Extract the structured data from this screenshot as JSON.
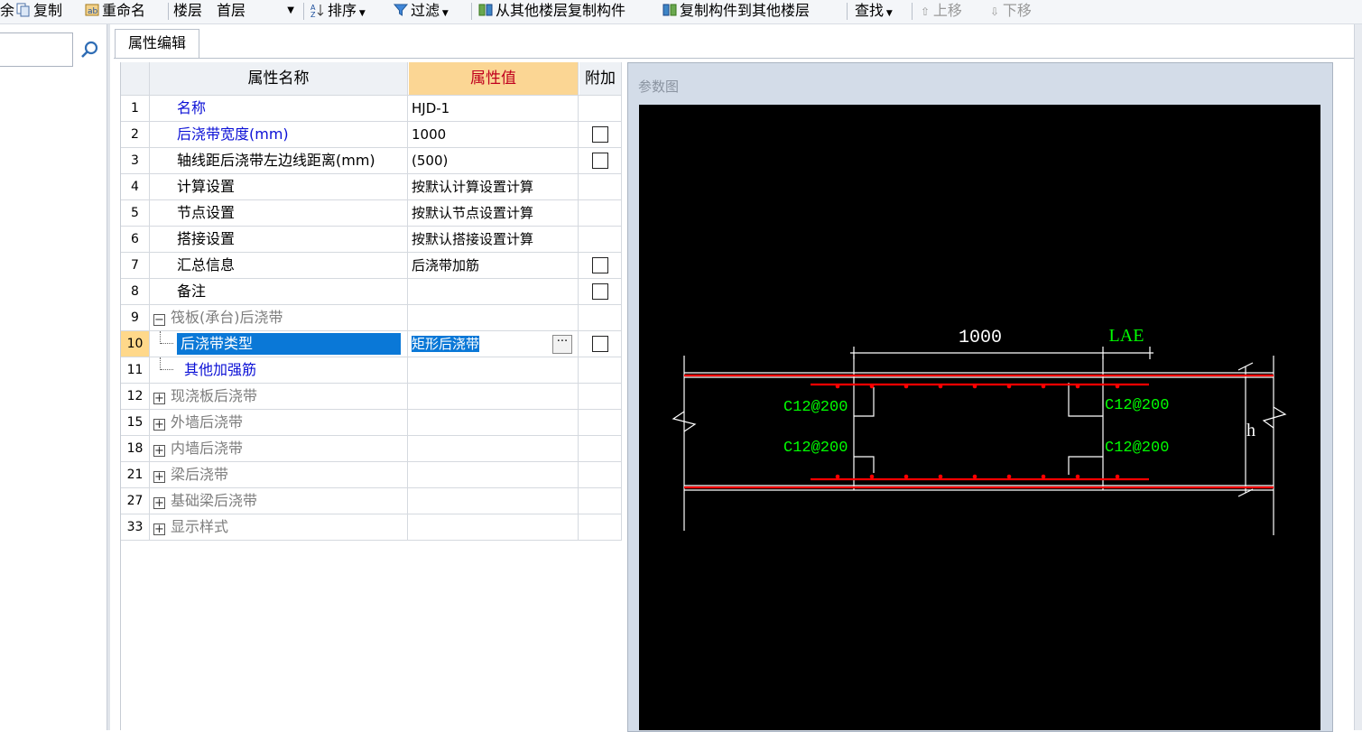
{
  "toolbar": {
    "delete_partial": "余",
    "copy": "复制",
    "rename": "重命名",
    "floor_label": "楼层",
    "floor_value": "首层",
    "sort": "排序",
    "filter": "过滤",
    "copy_from_floor": "从其他楼层复制构件",
    "copy_to_floor": "复制构件到其他楼层",
    "find": "查找",
    "move_up": "上移",
    "move_down": "下移"
  },
  "tab": {
    "label": "属性编辑"
  },
  "grid": {
    "headers": {
      "name": "属性名称",
      "value": "属性值",
      "extra": "附加"
    },
    "rows": [
      {
        "num": "1",
        "name": "名称",
        "value": "HJD-1",
        "checkbox": false
      },
      {
        "num": "2",
        "name": "后浇带宽度(mm)",
        "value": "1000",
        "checkbox": true
      },
      {
        "num": "3",
        "name": "轴线距后浇带左边线距离(mm)",
        "value": "(500)",
        "checkbox": true
      },
      {
        "num": "4",
        "name": "计算设置",
        "value": "按默认计算设置计算",
        "checkbox": false
      },
      {
        "num": "5",
        "name": "节点设置",
        "value": "按默认节点设置计算",
        "checkbox": false
      },
      {
        "num": "6",
        "name": "搭接设置",
        "value": "按默认搭接设置计算",
        "checkbox": false
      },
      {
        "num": "7",
        "name": "汇总信息",
        "value": "后浇带加筋",
        "checkbox": true
      },
      {
        "num": "8",
        "name": "备注",
        "value": "",
        "checkbox": true
      },
      {
        "num": "9",
        "name": "筏板(承台)后浇带",
        "value": "",
        "checkbox": false
      },
      {
        "num": "10",
        "name": "后浇带类型",
        "value": "矩形后浇带",
        "checkbox": true
      },
      {
        "num": "11",
        "name": "其他加强筋",
        "value": "",
        "checkbox": false
      },
      {
        "num": "12",
        "name": "现浇板后浇带",
        "value": "",
        "checkbox": false
      },
      {
        "num": "15",
        "name": "外墙后浇带",
        "value": "",
        "checkbox": false
      },
      {
        "num": "18",
        "name": "内墙后浇带",
        "value": "",
        "checkbox": false
      },
      {
        "num": "21",
        "name": "梁后浇带",
        "value": "",
        "checkbox": false
      },
      {
        "num": "27",
        "name": "基础梁后浇带",
        "value": "",
        "checkbox": false
      },
      {
        "num": "33",
        "name": "显示样式",
        "value": "",
        "checkbox": false
      }
    ],
    "ellipsis": "···"
  },
  "panel": {
    "title": "参数图",
    "width_dim": "1000",
    "lae": "LAE",
    "rebar_tl": "C12@200",
    "rebar_tr": "C12@200",
    "rebar_bl": "C12@200",
    "rebar_br": "C12@200",
    "h": "h"
  },
  "colors": {
    "highlight": "#0a78d7",
    "header_value_bg": "#fbd694",
    "header_value_text": "#c0001e",
    "rebar_red": "#ff0000",
    "label_green": "#00ff00",
    "canvas_bg": "#000000"
  }
}
